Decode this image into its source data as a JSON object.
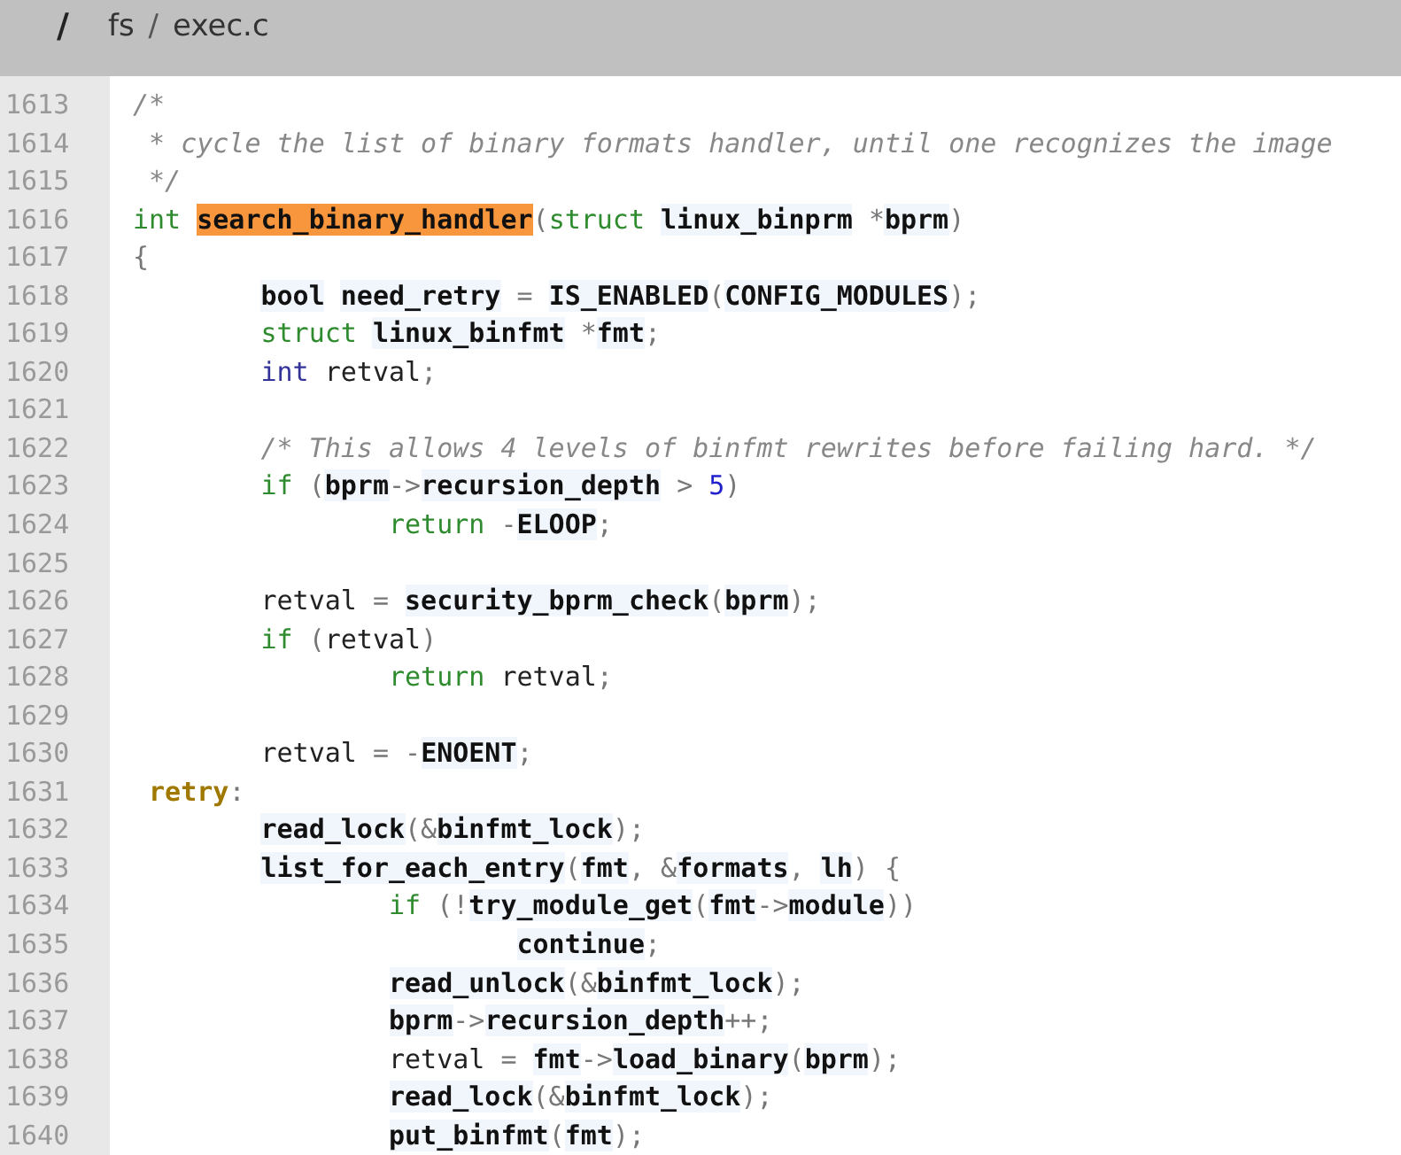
{
  "breadcrumb": [
    {
      "kind": "root",
      "label": "/"
    },
    {
      "kind": "dir",
      "label": "fs"
    },
    {
      "kind": "sep",
      "label": "/"
    },
    {
      "kind": "file",
      "label": "exec.c"
    }
  ],
  "lines": [
    {
      "number": "1613",
      "tokens": [
        {
          "kind": "cm",
          "text": "/*"
        }
      ]
    },
    {
      "number": "1614",
      "tokens": [
        {
          "kind": "cm",
          "text": " * cycle the list of binary formats handler, until one recognizes the image"
        }
      ]
    },
    {
      "number": "1615",
      "tokens": [
        {
          "kind": "cm",
          "text": " */"
        }
      ]
    },
    {
      "number": "1616",
      "tokens": [
        {
          "kind": "kw",
          "text": "int "
        },
        {
          "kind": "hl",
          "text": "search_binary_handler"
        },
        {
          "kind": "op",
          "text": "("
        },
        {
          "kind": "kw",
          "text": "struct "
        },
        {
          "kind": "id",
          "text": "linux_binprm "
        },
        {
          "kind": "op",
          "text": "*"
        },
        {
          "kind": "id",
          "text": "bprm"
        },
        {
          "kind": "op",
          "text": ")"
        }
      ]
    },
    {
      "number": "1617",
      "tokens": [
        {
          "kind": "op",
          "text": "{"
        }
      ]
    },
    {
      "number": "1618",
      "tokens": [
        {
          "kind": "id",
          "text": "\tbool "
        },
        {
          "kind": "id",
          "text": "need_retry "
        },
        {
          "kind": "op",
          "text": "= "
        },
        {
          "kind": "id",
          "text": "IS_ENABLED"
        },
        {
          "kind": "op",
          "text": "("
        },
        {
          "kind": "id",
          "text": "CONFIG_MODULES"
        },
        {
          "kind": "op",
          "text": ");"
        }
      ]
    },
    {
      "number": "1619",
      "tokens": [
        {
          "kind": "kw",
          "text": "\tstruct "
        },
        {
          "kind": "id",
          "text": "linux_binfmt "
        },
        {
          "kind": "op",
          "text": "*"
        },
        {
          "kind": "id",
          "text": "fmt"
        },
        {
          "kind": "op",
          "text": ";"
        }
      ]
    },
    {
      "number": "1620",
      "tokens": [
        {
          "kind": "dk",
          "text": "\tint "
        },
        {
          "kind": "p",
          "text": "retval"
        },
        {
          "kind": "op",
          "text": ";"
        }
      ]
    },
    {
      "number": "1621"
    },
    {
      "number": "1622",
      "tokens": [
        {
          "kind": "cm",
          "text": "\t/* This allows 4 levels of binfmt rewrites before failing hard. */"
        }
      ]
    },
    {
      "number": "1623",
      "tokens": [
        {
          "kind": "kw",
          "text": "\tif "
        },
        {
          "kind": "op",
          "text": "("
        },
        {
          "kind": "id",
          "text": "bprm"
        },
        {
          "kind": "op",
          "text": "->"
        },
        {
          "kind": "id",
          "text": "recursion_depth "
        },
        {
          "kind": "op",
          "text": "> "
        },
        {
          "kind": "num",
          "text": "5"
        },
        {
          "kind": "op",
          "text": ")"
        }
      ]
    },
    {
      "number": "1624",
      "tokens": [
        {
          "kind": "kw",
          "text": "\t\treturn "
        },
        {
          "kind": "op",
          "text": "-"
        },
        {
          "kind": "id",
          "text": "ELOOP"
        },
        {
          "kind": "op",
          "text": ";"
        }
      ]
    },
    {
      "number": "1625"
    },
    {
      "number": "1626",
      "tokens": [
        {
          "kind": "p",
          "text": "\tretval "
        },
        {
          "kind": "op",
          "text": "= "
        },
        {
          "kind": "id",
          "text": "security_bprm_check"
        },
        {
          "kind": "op",
          "text": "("
        },
        {
          "kind": "id",
          "text": "bprm"
        },
        {
          "kind": "op",
          "text": ");"
        }
      ]
    },
    {
      "number": "1627",
      "tokens": [
        {
          "kind": "kw",
          "text": "\tif "
        },
        {
          "kind": "op",
          "text": "("
        },
        {
          "kind": "p",
          "text": "retval"
        },
        {
          "kind": "op",
          "text": ")"
        }
      ]
    },
    {
      "number": "1628",
      "tokens": [
        {
          "kind": "kw",
          "text": "\t\treturn "
        },
        {
          "kind": "p",
          "text": "retval"
        },
        {
          "kind": "op",
          "text": ";"
        }
      ]
    },
    {
      "number": "1629"
    },
    {
      "number": "1630",
      "tokens": [
        {
          "kind": "p",
          "text": "\tretval "
        },
        {
          "kind": "op",
          "text": "= -"
        },
        {
          "kind": "id",
          "text": "ENOENT"
        },
        {
          "kind": "op",
          "text": ";"
        }
      ]
    },
    {
      "number": "1631",
      "tokens": [
        {
          "kind": "label",
          "text": " retry"
        },
        {
          "kind": "op",
          "text": ":"
        }
      ]
    },
    {
      "number": "1632",
      "tokens": [
        {
          "kind": "id",
          "text": "\tread_lock"
        },
        {
          "kind": "op",
          "text": "(&"
        },
        {
          "kind": "id",
          "text": "binfmt_lock"
        },
        {
          "kind": "op",
          "text": ");"
        }
      ]
    },
    {
      "number": "1633",
      "tokens": [
        {
          "kind": "id",
          "text": "\tlist_for_each_entry"
        },
        {
          "kind": "op",
          "text": "("
        },
        {
          "kind": "id",
          "text": "fmt"
        },
        {
          "kind": "op",
          "text": ", &"
        },
        {
          "kind": "id",
          "text": "formats"
        },
        {
          "kind": "op",
          "text": ", "
        },
        {
          "kind": "id",
          "text": "lh"
        },
        {
          "kind": "op",
          "text": ") {"
        }
      ]
    },
    {
      "number": "1634",
      "tokens": [
        {
          "kind": "kw",
          "text": "\t\tif "
        },
        {
          "kind": "op",
          "text": "(!"
        },
        {
          "kind": "id",
          "text": "try_module_get"
        },
        {
          "kind": "op",
          "text": "("
        },
        {
          "kind": "id",
          "text": "fmt"
        },
        {
          "kind": "op",
          "text": "->"
        },
        {
          "kind": "id",
          "text": "module"
        },
        {
          "kind": "op",
          "text": "))"
        }
      ]
    },
    {
      "number": "1635",
      "tokens": [
        {
          "kind": "id",
          "text": "\t\t\tcontinue"
        },
        {
          "kind": "op",
          "text": ";"
        }
      ]
    },
    {
      "number": "1636",
      "tokens": [
        {
          "kind": "id",
          "text": "\t\tread_unlock"
        },
        {
          "kind": "op",
          "text": "(&"
        },
        {
          "kind": "id",
          "text": "binfmt_lock"
        },
        {
          "kind": "op",
          "text": ");"
        }
      ]
    },
    {
      "number": "1637",
      "tokens": [
        {
          "kind": "id",
          "text": "\t\tbprm"
        },
        {
          "kind": "op",
          "text": "->"
        },
        {
          "kind": "id",
          "text": "recursion_depth"
        },
        {
          "kind": "op",
          "text": "++;"
        }
      ]
    },
    {
      "number": "1638",
      "tokens": [
        {
          "kind": "p",
          "text": "\t\tretval "
        },
        {
          "kind": "op",
          "text": "= "
        },
        {
          "kind": "id",
          "text": "fmt"
        },
        {
          "kind": "op",
          "text": "->"
        },
        {
          "kind": "id",
          "text": "load_binary"
        },
        {
          "kind": "op",
          "text": "("
        },
        {
          "kind": "id",
          "text": "bprm"
        },
        {
          "kind": "op",
          "text": ");"
        }
      ]
    },
    {
      "number": "1639",
      "tokens": [
        {
          "kind": "id",
          "text": "\t\tread_lock"
        },
        {
          "kind": "op",
          "text": "(&"
        },
        {
          "kind": "id",
          "text": "binfmt_lock"
        },
        {
          "kind": "op",
          "text": ");"
        }
      ]
    },
    {
      "number": "1640",
      "tokens": [
        {
          "kind": "id",
          "text": "\t\tput_binfmt"
        },
        {
          "kind": "op",
          "text": "("
        },
        {
          "kind": "id",
          "text": "fmt"
        },
        {
          "kind": "op",
          "text": ");"
        }
      ]
    }
  ]
}
